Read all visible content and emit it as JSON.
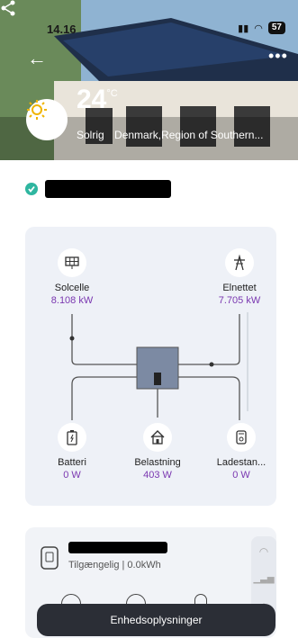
{
  "status_bar": {
    "time": "14.16",
    "battery": "57"
  },
  "weather": {
    "temperature": "24",
    "unit": "°C",
    "condition": "Solrig",
    "location": "Denmark,Region of Southern..."
  },
  "flow": {
    "solar": {
      "label": "Solcelle",
      "value": "8.108 kW"
    },
    "grid": {
      "label": "Elnettet",
      "value": "7.705 kW"
    },
    "battery": {
      "label": "Batteri",
      "value": "0 W"
    },
    "load": {
      "label": "Belastning",
      "value": "403 W"
    },
    "charger": {
      "label": "Ladestan...",
      "value": "0 W"
    }
  },
  "device": {
    "status": "Tilgængelig | 0.0kWh"
  },
  "bottom_button": {
    "label": "Enhedsoplysninger"
  },
  "colors": {
    "accent": "#7a37b0",
    "check": "#2fb6a0",
    "button_bg": "#2b2e36"
  }
}
